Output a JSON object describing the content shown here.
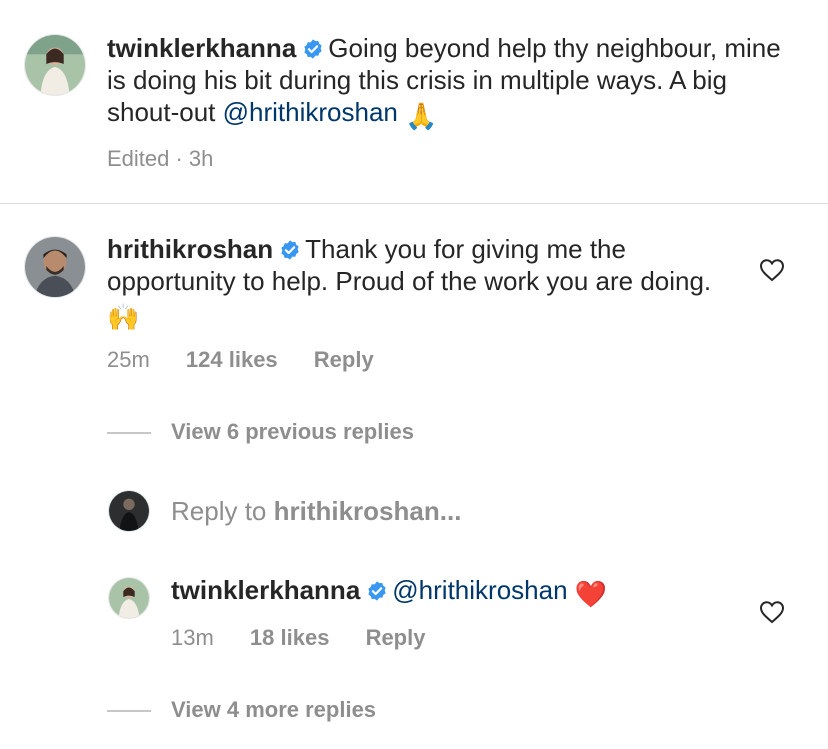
{
  "caption": {
    "username": "twinklerkhanna",
    "text": "Going beyond help thy neighbour, mine is doing his bit during this crisis in multiple ways. A big shout-out ",
    "mention": "@hrithikroshan",
    "emoji": "🙏",
    "meta": "Edited · 3h"
  },
  "comment": {
    "username": "hrithikroshan",
    "text": "Thank you for giving me the opportunity to help. Proud of the work you are doing. ",
    "emoji": "🙌",
    "time": "25m",
    "likes": "124 likes",
    "reply": "Reply",
    "view_previous": "View 6 previous replies",
    "reply_prompt_prefix": "Reply to ",
    "reply_prompt_user": "hrithikroshan..."
  },
  "reply": {
    "username": "twinklerkhanna",
    "mention": "@hrithikroshan",
    "emoji": "❤️",
    "time": "13m",
    "likes": "18 likes",
    "reply": "Reply",
    "view_more": "View 4 more replies"
  },
  "icons": {
    "verified": "verified-badge-icon",
    "heart": "heart-outline-icon"
  },
  "colors": {
    "verified": "#3897f0",
    "mention": "#00376b",
    "meta": "#8e8e8e",
    "heart_emoji": "#e0245e"
  }
}
